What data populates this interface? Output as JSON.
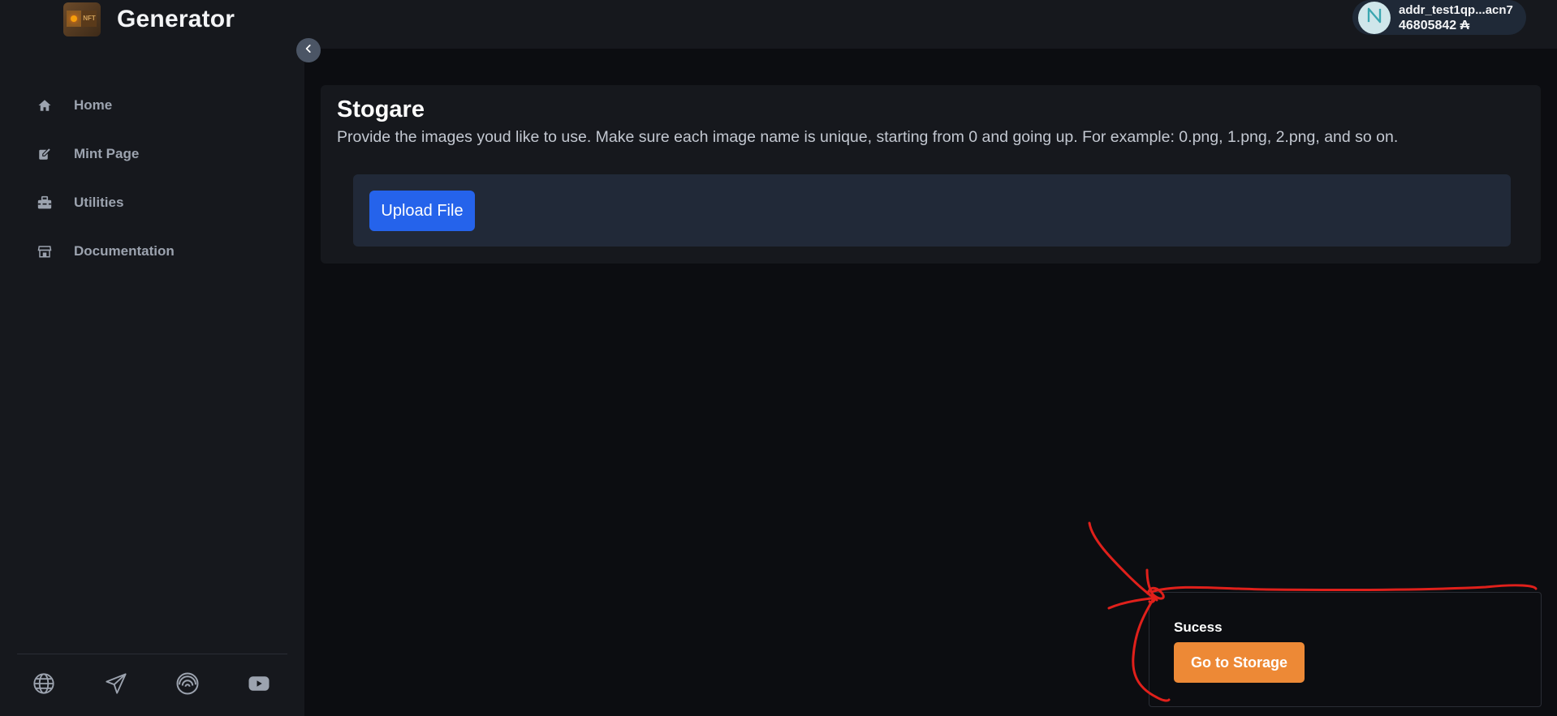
{
  "app": {
    "title": "Generator"
  },
  "sidebar": {
    "items": [
      {
        "label": "Home",
        "icon": "home-icon"
      },
      {
        "label": "Mint Page",
        "icon": "edit-icon"
      },
      {
        "label": "Utilities",
        "icon": "toolbox-icon"
      },
      {
        "label": "Documentation",
        "icon": "store-icon"
      }
    ],
    "social": [
      "globe-icon",
      "send-icon",
      "rainbow-icon",
      "youtube-icon"
    ]
  },
  "wallet": {
    "address": "addr_test1qp...acn7",
    "balance": "46805842 ₳"
  },
  "main": {
    "title": "Stogare",
    "description": "Provide the images youd like to use. Make sure each image name is unique, starting from 0 and going up. For example: 0.png, 1.png, 2.png, and so on.",
    "upload_label": "Upload File"
  },
  "toast": {
    "title": "Sucess",
    "button_label": "Go to Storage"
  },
  "colors": {
    "background": "#0c0d11",
    "sidebar": "#16181d",
    "primary_button": "#2563eb",
    "toast_button": "#ed8936",
    "annotation": "#e0201b"
  }
}
